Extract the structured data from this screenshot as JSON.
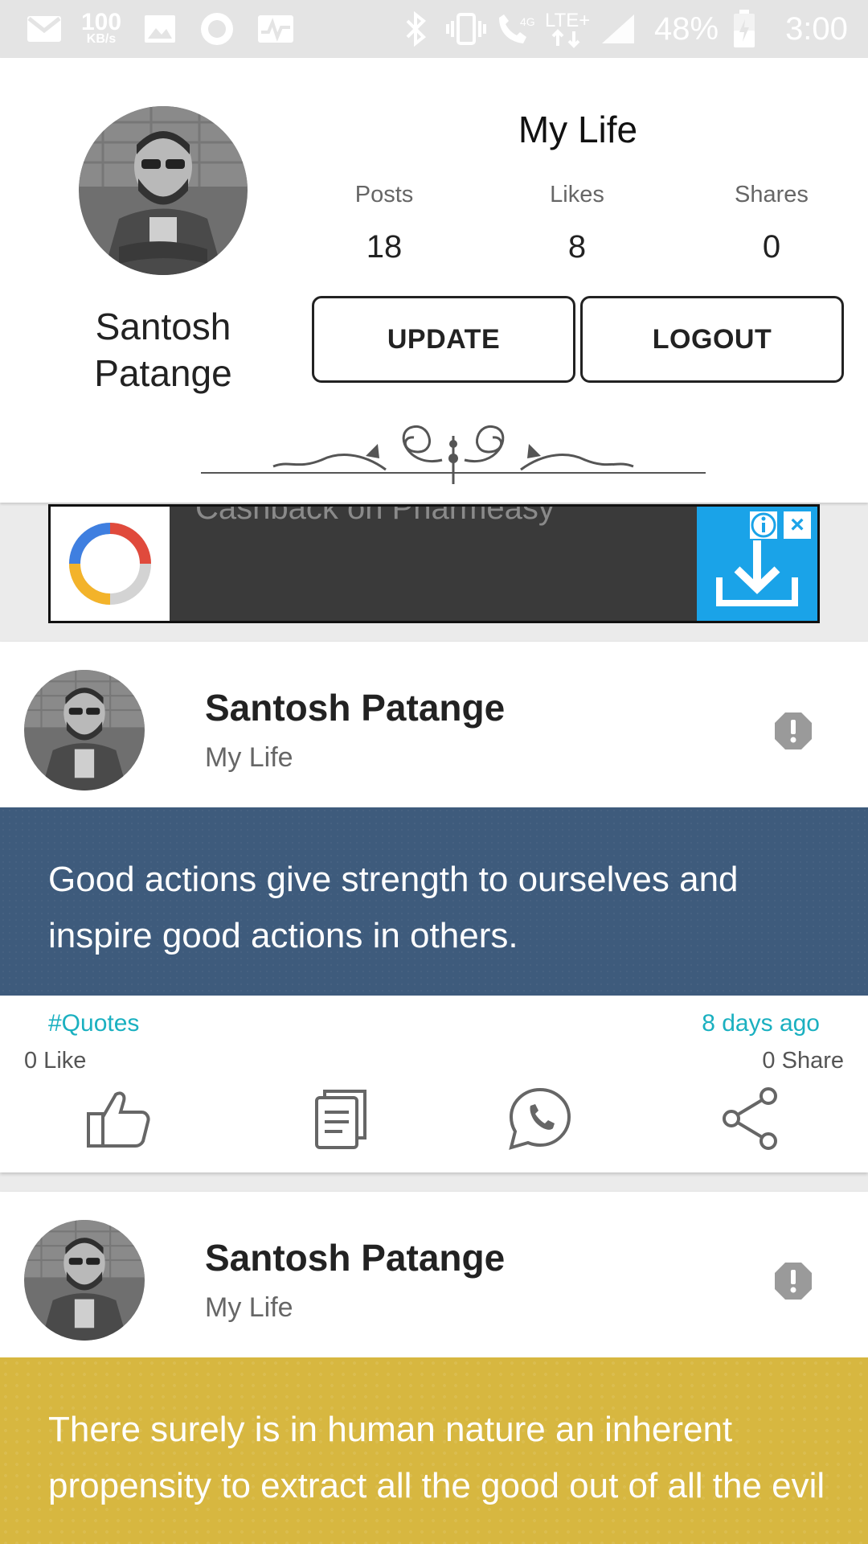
{
  "status_bar": {
    "speed": "100",
    "speed_unit": "KB/s",
    "network": "4G LTE+",
    "battery": "48%",
    "time": "3:00"
  },
  "profile": {
    "name_line1": "Santosh",
    "name_line2": "Patange",
    "title": "My Life",
    "stats": [
      {
        "label": "Posts",
        "value": "18"
      },
      {
        "label": "Likes",
        "value": "8"
      },
      {
        "label": "Shares",
        "value": "0"
      }
    ],
    "update_label": "UPDATE",
    "logout_label": "LOGOUT"
  },
  "ad": {
    "text": "Cashback on Pharmeasy"
  },
  "posts": [
    {
      "author": "Santosh Patange",
      "category": "My Life",
      "quote": "Good actions give strength to ourselves and inspire good actions in others.",
      "tag": "#Quotes",
      "time": "8 days ago",
      "likes": "0 Like",
      "shares": "0 Share",
      "bg_color": "#3e5b7c"
    },
    {
      "author": "Santosh Patange",
      "category": "My Life",
      "quote": "There surely is in human nature an inherent propensity to extract all the good out of all the evil",
      "bg_color": "#d7b740"
    }
  ],
  "colors": {
    "accent": "#1ab0c0",
    "ad_blue": "#1aa3e8"
  }
}
